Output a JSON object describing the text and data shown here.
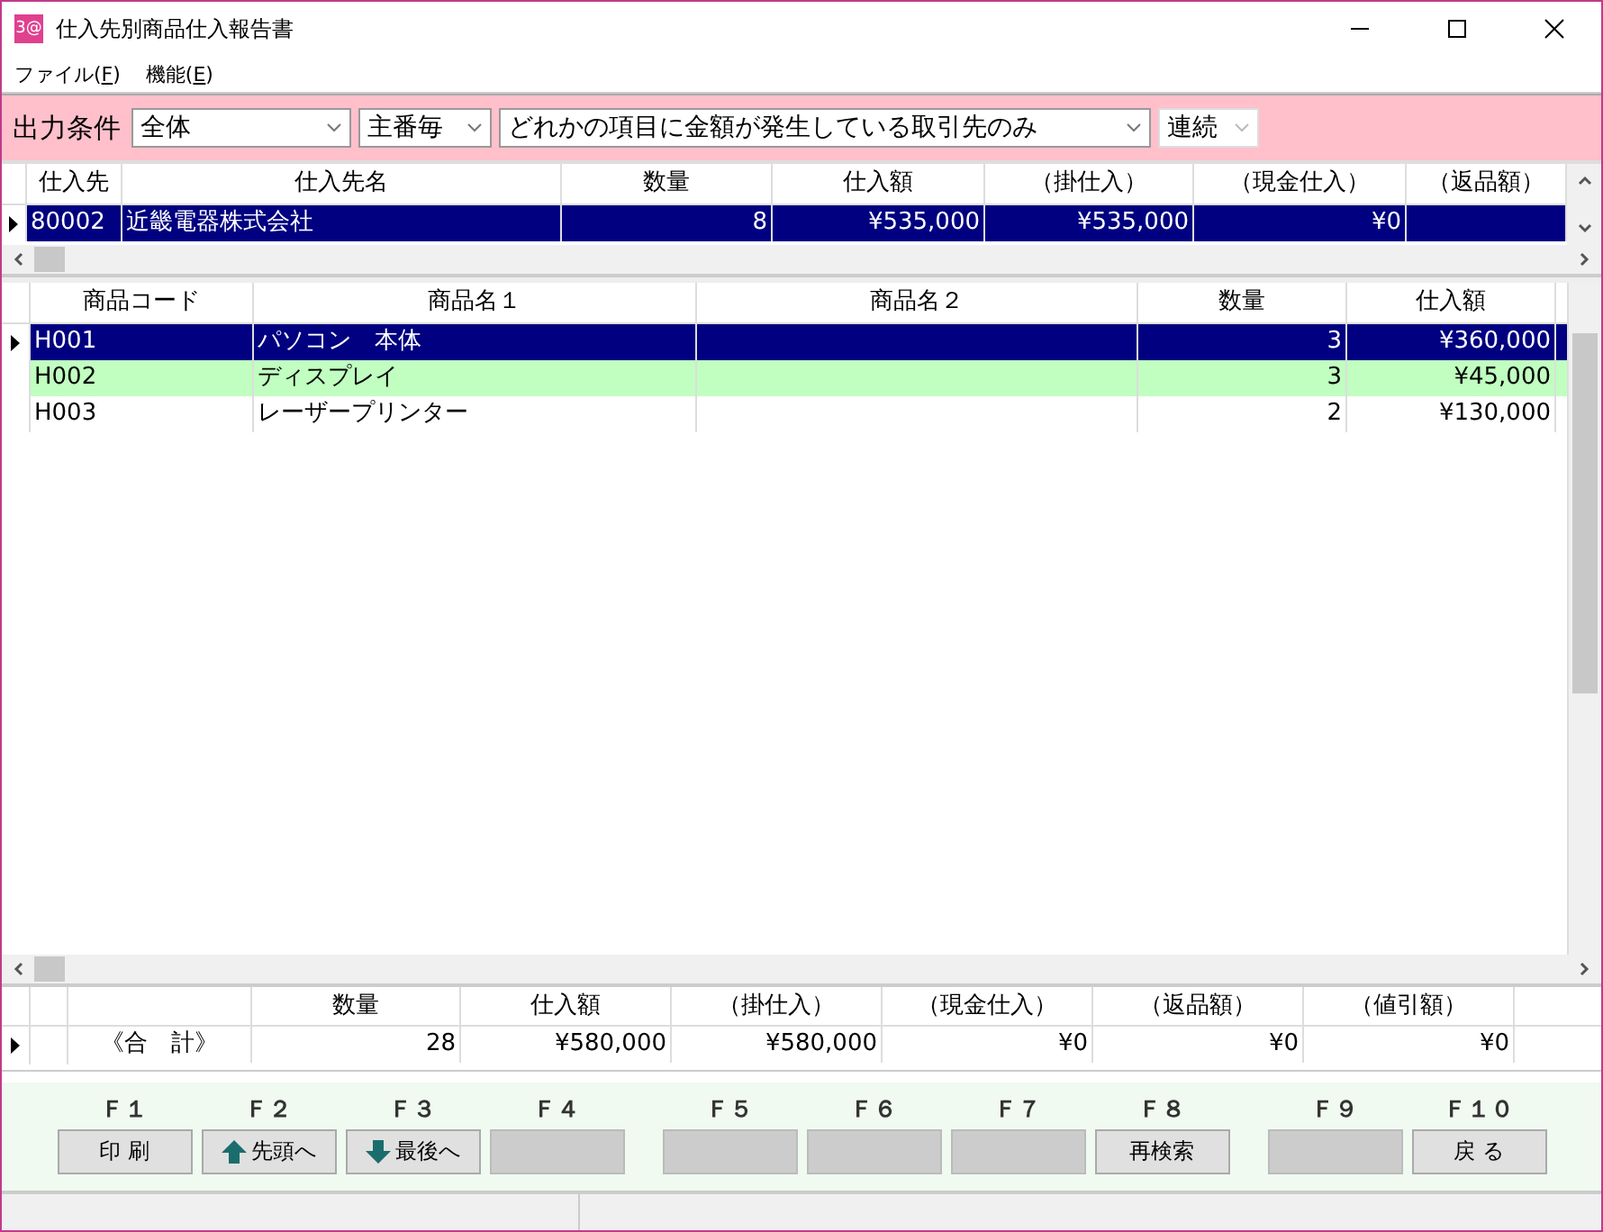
{
  "window": {
    "title": "仕入先別商品仕入報告書",
    "icon_text": "3@"
  },
  "menu": [
    {
      "label": "ファイル(",
      "key": "F",
      "end": ")"
    },
    {
      "label": "機能(",
      "key": "E",
      "end": ")"
    }
  ],
  "filter": {
    "label": "出力条件",
    "selects": [
      {
        "value": "全体",
        "disabled": false
      },
      {
        "value": "主番毎",
        "disabled": false
      },
      {
        "value": "どれかの項目に金額が発生している取引先のみ",
        "disabled": false
      },
      {
        "value": "連続",
        "disabled": true
      }
    ]
  },
  "supplier_table": {
    "columns": [
      "仕入先",
      "仕入先名",
      "数量",
      "仕入額",
      "（掛仕入）",
      "（現金仕入）",
      "（返品額）"
    ],
    "rows": [
      {
        "selected": true,
        "cells": [
          "80002",
          "近畿電器株式会社",
          "8",
          "¥535,000",
          "¥535,000",
          "¥0",
          ""
        ]
      }
    ]
  },
  "item_table": {
    "columns": [
      "商品コード",
      "商品名１",
      "商品名２",
      "数量",
      "仕入額"
    ],
    "rows": [
      {
        "selected": true,
        "highlighted": false,
        "cells": [
          "H001",
          "パソコン　本体",
          "",
          "3",
          "¥360,000"
        ]
      },
      {
        "selected": false,
        "highlighted": true,
        "cells": [
          "H002",
          "ディスプレイ",
          "",
          "3",
          "¥45,000"
        ]
      },
      {
        "selected": false,
        "highlighted": false,
        "cells": [
          "H003",
          "レーザープリンター",
          "",
          "2",
          "¥130,000"
        ]
      }
    ]
  },
  "total_table": {
    "columns": [
      "",
      "数量",
      "仕入額",
      "（掛仕入）",
      "（現金仕入）",
      "（返品額）",
      "（値引額）"
    ],
    "rows": [
      {
        "cells": [
          "《合　計》",
          "28",
          "¥580,000",
          "¥580,000",
          "¥0",
          "¥0",
          "¥0"
        ]
      }
    ]
  },
  "function_keys": [
    {
      "key": "Ｆ１",
      "label": "印 刷",
      "kind": "plain",
      "disabled": false
    },
    {
      "key": "Ｆ２",
      "label": "先頭へ",
      "kind": "first",
      "disabled": false
    },
    {
      "key": "Ｆ３",
      "label": "最後へ",
      "kind": "last",
      "disabled": false
    },
    {
      "key": "Ｆ４",
      "kind": "plain",
      "disabled": true
    },
    {
      "key": "Ｆ５",
      "kind": "plain",
      "disabled": true
    },
    {
      "key": "Ｆ６",
      "kind": "plain",
      "disabled": true
    },
    {
      "key": "Ｆ７",
      "kind": "plain",
      "disabled": true
    },
    {
      "key": "Ｆ８",
      "label": "再検索",
      "kind": "plain",
      "disabled": false
    },
    {
      "key": "Ｆ９",
      "kind": "plain",
      "disabled": true
    },
    {
      "key": "Ｆ１０",
      "label": "戻 る",
      "kind": "plain",
      "disabled": false
    }
  ]
}
